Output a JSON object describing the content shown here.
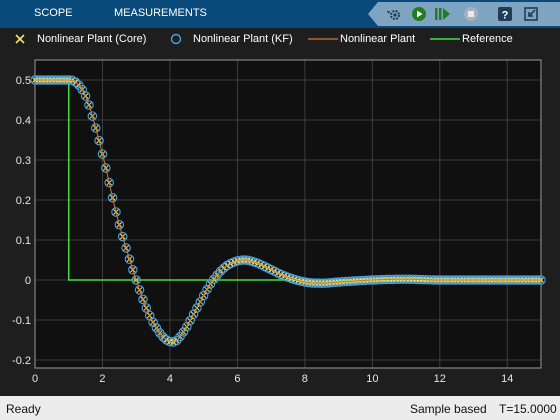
{
  "toolbar": {
    "tabs": [
      "SCOPE",
      "MEASUREMENTS"
    ],
    "icons": [
      "dropdown-arrow-icon",
      "settings-gear-icon",
      "run-icon",
      "step-forward-icon",
      "stop-icon",
      "help-icon",
      "undock-icon"
    ]
  },
  "legend": [
    {
      "label": "Nonlinear Plant (Core)",
      "marker": "x",
      "color": "#f2e266"
    },
    {
      "label": "Nonlinear Plant (KF)",
      "marker": "o",
      "color": "#4aa3df"
    },
    {
      "label": "Nonlinear Plant",
      "marker": "line",
      "color": "#d5782c"
    },
    {
      "label": "Reference",
      "marker": "line",
      "color": "#3fe03f"
    }
  ],
  "chart_data": {
    "type": "line",
    "title": "",
    "xlabel": "",
    "ylabel": "",
    "xlim": [
      0,
      15
    ],
    "ylim": [
      -0.22,
      0.55
    ],
    "xticks": [
      "0",
      "2",
      "4",
      "6",
      "8",
      "10",
      "12",
      "14"
    ],
    "yticks": [
      "0.5",
      "0.4",
      "0.3",
      "0.2",
      "0.1",
      "0",
      "-0.1",
      "-0.2"
    ],
    "grid": true,
    "series": [
      {
        "name": "Reference",
        "color": "#3fe03f",
        "x": [
          0,
          1,
          1,
          15
        ],
        "y": [
          0.5,
          0.5,
          0,
          0
        ]
      },
      {
        "name": "Nonlinear Plant",
        "color": "#d5782c",
        "x": [
          0,
          1.0,
          1.2,
          1.5,
          1.8,
          2.1,
          2.4,
          2.7,
          3.0,
          3.3,
          3.6,
          3.9,
          4.1,
          4.4,
          4.8,
          5.2,
          5.6,
          5.9,
          6.2,
          6.5,
          6.9,
          7.4,
          8.0,
          8.5,
          9.0,
          10.0,
          11.0,
          12.0,
          13.0,
          14.0,
          15.0
        ],
        "y": [
          0.5,
          0.5,
          0.495,
          0.46,
          0.38,
          0.28,
          0.17,
          0.08,
          0.0,
          -0.07,
          -0.12,
          -0.15,
          -0.155,
          -0.13,
          -0.07,
          -0.01,
          0.03,
          0.045,
          0.05,
          0.045,
          0.03,
          0.01,
          -0.005,
          -0.008,
          -0.005,
          0.0,
          0.002,
          0.0,
          0.0,
          0.0,
          0.0
        ]
      },
      {
        "name": "Nonlinear Plant (Core)",
        "color": "#f2e266",
        "marker": "x",
        "x": [
          0,
          1.0,
          1.2,
          1.5,
          1.8,
          2.1,
          2.4,
          2.7,
          3.0,
          3.3,
          3.6,
          3.9,
          4.1,
          4.4,
          4.8,
          5.2,
          5.6,
          5.9,
          6.2,
          6.5,
          6.9,
          7.4,
          8.0,
          8.5,
          9.0,
          10.0,
          11.0,
          12.0,
          13.0,
          14.0,
          15.0
        ],
        "y": [
          0.5,
          0.5,
          0.495,
          0.46,
          0.38,
          0.28,
          0.17,
          0.08,
          0.0,
          -0.07,
          -0.12,
          -0.15,
          -0.155,
          -0.13,
          -0.07,
          -0.01,
          0.03,
          0.045,
          0.05,
          0.045,
          0.03,
          0.01,
          -0.005,
          -0.008,
          -0.005,
          0.0,
          0.002,
          0.0,
          0.0,
          0.0,
          0.0
        ]
      },
      {
        "name": "Nonlinear Plant (KF)",
        "color": "#4aa3df",
        "marker": "o",
        "x": [
          0,
          1.0,
          1.2,
          1.5,
          1.8,
          2.1,
          2.4,
          2.7,
          3.0,
          3.3,
          3.6,
          3.9,
          4.1,
          4.4,
          4.8,
          5.2,
          5.6,
          5.9,
          6.2,
          6.5,
          6.9,
          7.4,
          8.0,
          8.5,
          9.0,
          10.0,
          11.0,
          12.0,
          13.0,
          14.0,
          15.0
        ],
        "y": [
          0.5,
          0.5,
          0.495,
          0.46,
          0.38,
          0.28,
          0.17,
          0.08,
          0.0,
          -0.07,
          -0.12,
          -0.15,
          -0.155,
          -0.13,
          -0.07,
          -0.01,
          0.03,
          0.045,
          0.05,
          0.045,
          0.03,
          0.01,
          -0.005,
          -0.008,
          -0.005,
          0.0,
          0.002,
          0.0,
          0.0,
          0.0,
          0.0
        ]
      }
    ]
  },
  "status": {
    "left": "Ready",
    "mode": "Sample based",
    "time": "T=15.0000"
  }
}
